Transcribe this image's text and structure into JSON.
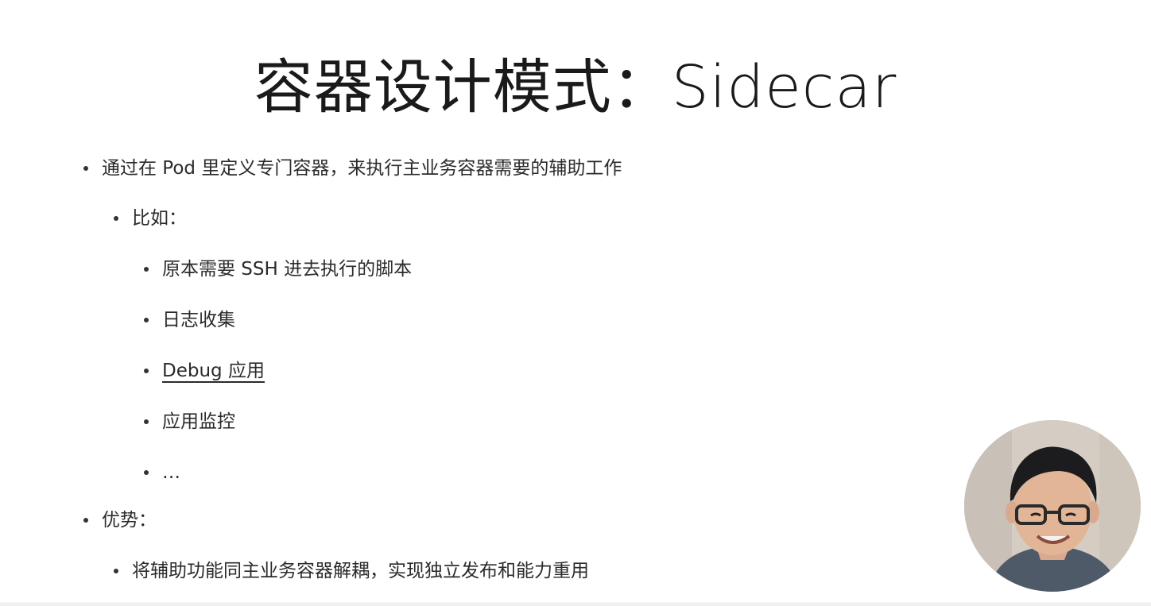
{
  "slide": {
    "title": "容器设计模式：Sidecar",
    "bullets": [
      {
        "level": 1,
        "text": "通过在 Pod 里定义专门容器，来执行主业务容器需要的辅助工作"
      },
      {
        "level": 2,
        "text": "比如："
      },
      {
        "level": 3,
        "text": "原本需要 SSH 进去执行的脚本"
      },
      {
        "level": 3,
        "text": "日志收集"
      },
      {
        "level": 3,
        "text": "Debug 应用"
      },
      {
        "level": 3,
        "text": "应用监控"
      },
      {
        "level": 3,
        "text": "…"
      },
      {
        "level": 1,
        "text": "优势："
      },
      {
        "level": 2,
        "text": "将辅助功能同主业务容器解耦，实现独立发布和能力重用"
      }
    ]
  },
  "colors": {
    "background": "#ffffff",
    "text": "#2b2b2b"
  }
}
